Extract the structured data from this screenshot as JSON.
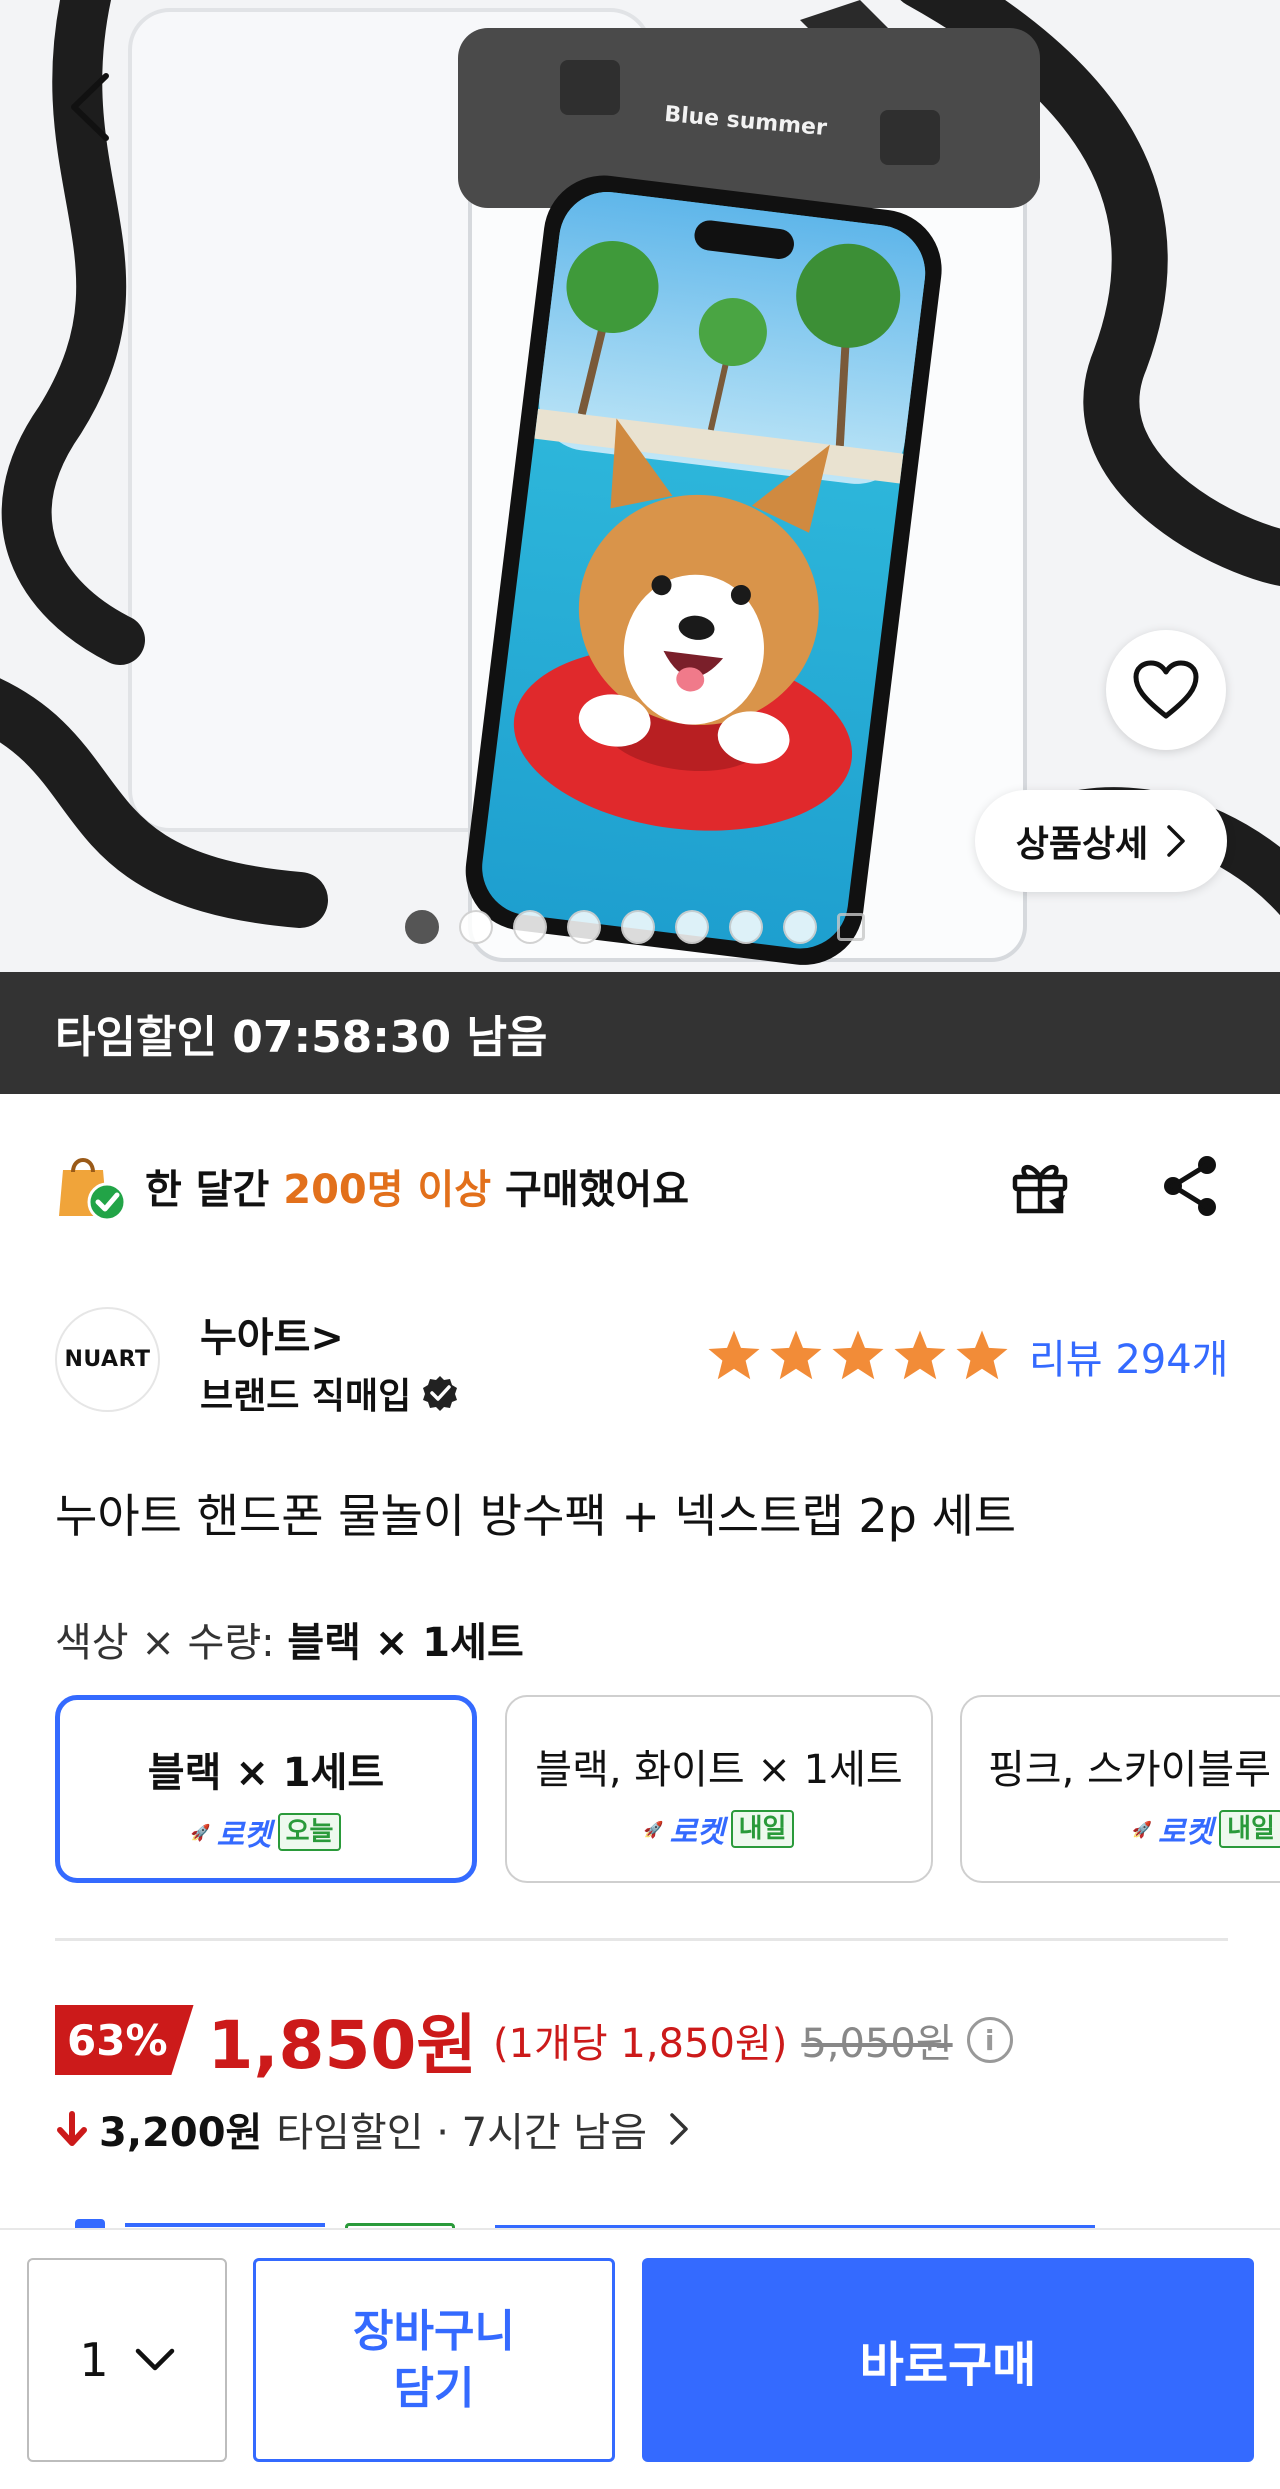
{
  "hero": {
    "brand_print": "Blue summer",
    "detail_label": "상품상세",
    "image_count": 8,
    "current_image": 1
  },
  "time_sale": {
    "banner_text": "타임할인 07:58:30 남음"
  },
  "purchase": {
    "prefix": "한 달간 ",
    "highlight": "200명 이상",
    "suffix": " 구매했어요",
    "highlight_color": "#e2701b"
  },
  "brand": {
    "logo_text": "NUART",
    "name": "누아트>",
    "subtitle": "브랜드 직매입",
    "rating_stars": 5,
    "review_label": "리뷰 294개"
  },
  "product": {
    "title": "누아트 핸드폰 물놀이 방수팩 + 넥스트랩 2p 세트"
  },
  "options": {
    "label": "색상 × 수량: ",
    "selected": "블랙 × 1세트",
    "items": [
      {
        "name": "블랙 × 1세트",
        "rocket": "로켓",
        "day": "오늘"
      },
      {
        "name": "블랙, 화이트 × 1세트",
        "rocket": "로켓",
        "day": "내일"
      },
      {
        "name": "핑크,  스카이블루",
        "rocket": "로켓",
        "day": "내일"
      }
    ]
  },
  "price": {
    "discount": "63%",
    "sale": "1,850원",
    "unit": "(1개당 1,850원)",
    "original": "5,050원",
    "time_discount_amount": "3,200원",
    "time_discount_text": "타임할인 · 7시간 남음",
    "accent_color": "#cc1a1a"
  },
  "bottom": {
    "quantity": "1",
    "cart_label": "장바구니\n담기",
    "buy_label": "바로구매",
    "primary_color": "#346aff"
  }
}
